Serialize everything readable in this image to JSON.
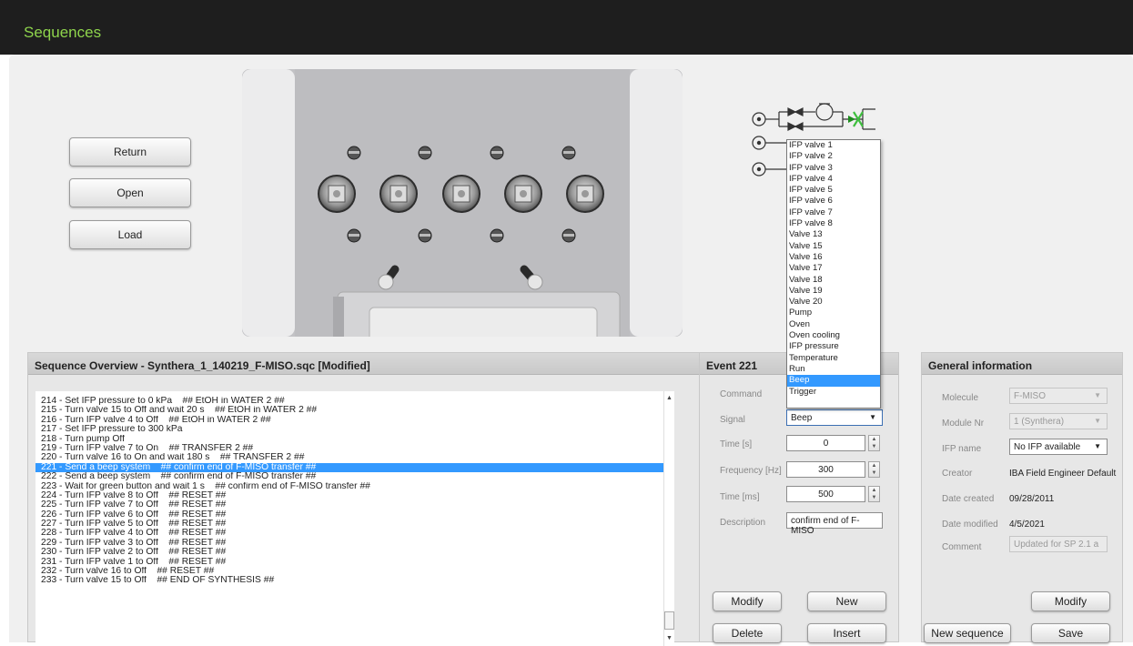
{
  "window": {
    "title": "Sequences"
  },
  "left_buttons": {
    "return": "Return",
    "open": "Open",
    "load": "Load"
  },
  "sequence": {
    "title": "Sequence Overview - Synthera_1_140219_F-MISO.sqc [Modified]",
    "rows": [
      "214 - Set IFP pressure to 0 kPa    ## EtOH in WATER 2 ##",
      "215 - Turn valve 15 to Off and wait 20 s    ## EtOH in WATER 2 ##",
      "216 - Turn IFP valve 4 to Off    ## EtOH in WATER 2 ##",
      "217 - Set IFP pressure to 300 kPa",
      "218 - Turn pump Off",
      "219 - Turn IFP valve 7 to On    ## TRANSFER 2 ##",
      "220 - Turn valve 16 to On and wait 180 s    ## TRANSFER 2 ##",
      "221 - Send a beep system    ## confirm end of F-MISO transfer ##",
      "222 - Send a beep system    ## confirm end of F-MISO transfer ##",
      "223 - Wait for green button and wait 1 s    ## confirm end of F-MISO transfer ##",
      "224 - Turn IFP valve 8 to Off    ## RESET ##",
      "225 - Turn IFP valve 7 to Off    ## RESET ##",
      "226 - Turn IFP valve 6 to Off    ## RESET ##",
      "227 - Turn IFP valve 5 to Off    ## RESET ##",
      "228 - Turn IFP valve 4 to Off    ## RESET ##",
      "229 - Turn IFP valve 3 to Off    ## RESET ##",
      "230 - Turn IFP valve 2 to Off    ## RESET ##",
      "231 - Turn IFP valve 1 to Off    ## RESET ##",
      "232 - Turn valve 16 to Off    ## RESET ##",
      "233 - Turn valve 15 to Off    ## END OF SYNTHESIS ##"
    ],
    "selected_index": 7
  },
  "event": {
    "title": "Event 221",
    "command_label": "Command",
    "signal_label": "Signal",
    "signal_value": "Beep",
    "time_s_label": "Time [s]",
    "time_s_value": "0",
    "freq_label": "Frequency [Hz]",
    "freq_value": "300",
    "time_ms_label": "Time [ms]",
    "time_ms_value": "500",
    "desc_label": "Description",
    "desc_value": "confirm end of F-MISO",
    "modify": "Modify",
    "new": "New",
    "delete": "Delete",
    "insert": "Insert"
  },
  "command_dropdown": {
    "options": [
      "IFP valve 1",
      "IFP valve 2",
      "IFP valve 3",
      "IFP valve 4",
      "IFP valve 5",
      "IFP valve 6",
      "IFP valve 7",
      "IFP valve 8",
      "Valve 13",
      "Valve 15",
      "Valve 16",
      "Valve 17",
      "Valve 18",
      "Valve 19",
      "Valve 20",
      "Pump",
      "Oven",
      "Oven cooling",
      "IFP pressure",
      "Temperature",
      "Run",
      "Beep",
      "Trigger"
    ],
    "highlighted_index": 21
  },
  "general": {
    "title": "General information",
    "molecule_label": "Molecule",
    "molecule_value": "F-MISO",
    "module_label": "Module Nr",
    "module_value": "1 (Synthera)",
    "ifp_label": "IFP name",
    "ifp_value": "No IFP available",
    "creator_label": "Creator",
    "creator_value": "IBA Field Engineer Default",
    "created_label": "Date created",
    "created_value": "09/28/2011",
    "modified_label": "Date modified",
    "modified_value": "4/5/2021",
    "comment_label": "Comment",
    "comment_value": "Updated for SP 2.1 a",
    "modify": "Modify",
    "new_sequence": "New sequence",
    "save": "Save"
  },
  "colors": {
    "title_green": "#8ed44c",
    "selection_blue": "#3399ff",
    "titlebar": "#1e1e1e"
  },
  "icons": [
    "valve-circle-icon",
    "chevron-down-icon",
    "spin-up-icon",
    "spin-down-icon"
  ]
}
